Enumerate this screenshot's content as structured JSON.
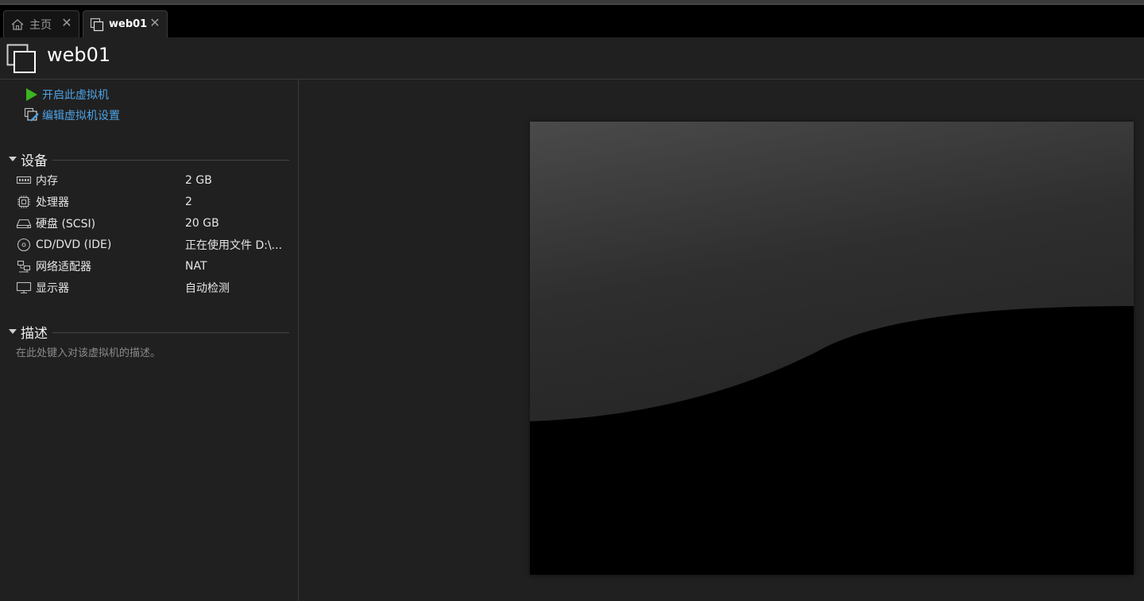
{
  "tabs": [
    {
      "label": "主页",
      "icon": "home-icon"
    },
    {
      "label": "web01",
      "icon": "vm-icon"
    }
  ],
  "header": {
    "title": "web01",
    "icon": "vm-icon"
  },
  "actions": [
    {
      "label": "开启此虚拟机",
      "icon": "play-icon"
    },
    {
      "label": "编辑虚拟机设置",
      "icon": "edit-settings-icon"
    }
  ],
  "devices": {
    "title": "设备",
    "items": [
      {
        "name": "内存",
        "value": "2 GB",
        "icon": "memory-icon"
      },
      {
        "name": "处理器",
        "value": "2",
        "icon": "cpu-icon"
      },
      {
        "name": "硬盘 (SCSI)",
        "value": "20 GB",
        "icon": "harddisk-icon"
      },
      {
        "name": "CD/DVD (IDE)",
        "value": "正在使用文件 D:\\...",
        "icon": "cd-dvd-icon"
      },
      {
        "name": "网络适配器",
        "value": "NAT",
        "icon": "network-adapter-icon"
      },
      {
        "name": "显示器",
        "value": "自动检测",
        "icon": "display-icon"
      }
    ]
  },
  "description": {
    "title": "描述",
    "placeholder": "在此处键入对该虚拟机的描述。"
  },
  "colors": {
    "accent_link": "#4ea3e6",
    "play_green": "#3cb521",
    "background": "#202020"
  }
}
